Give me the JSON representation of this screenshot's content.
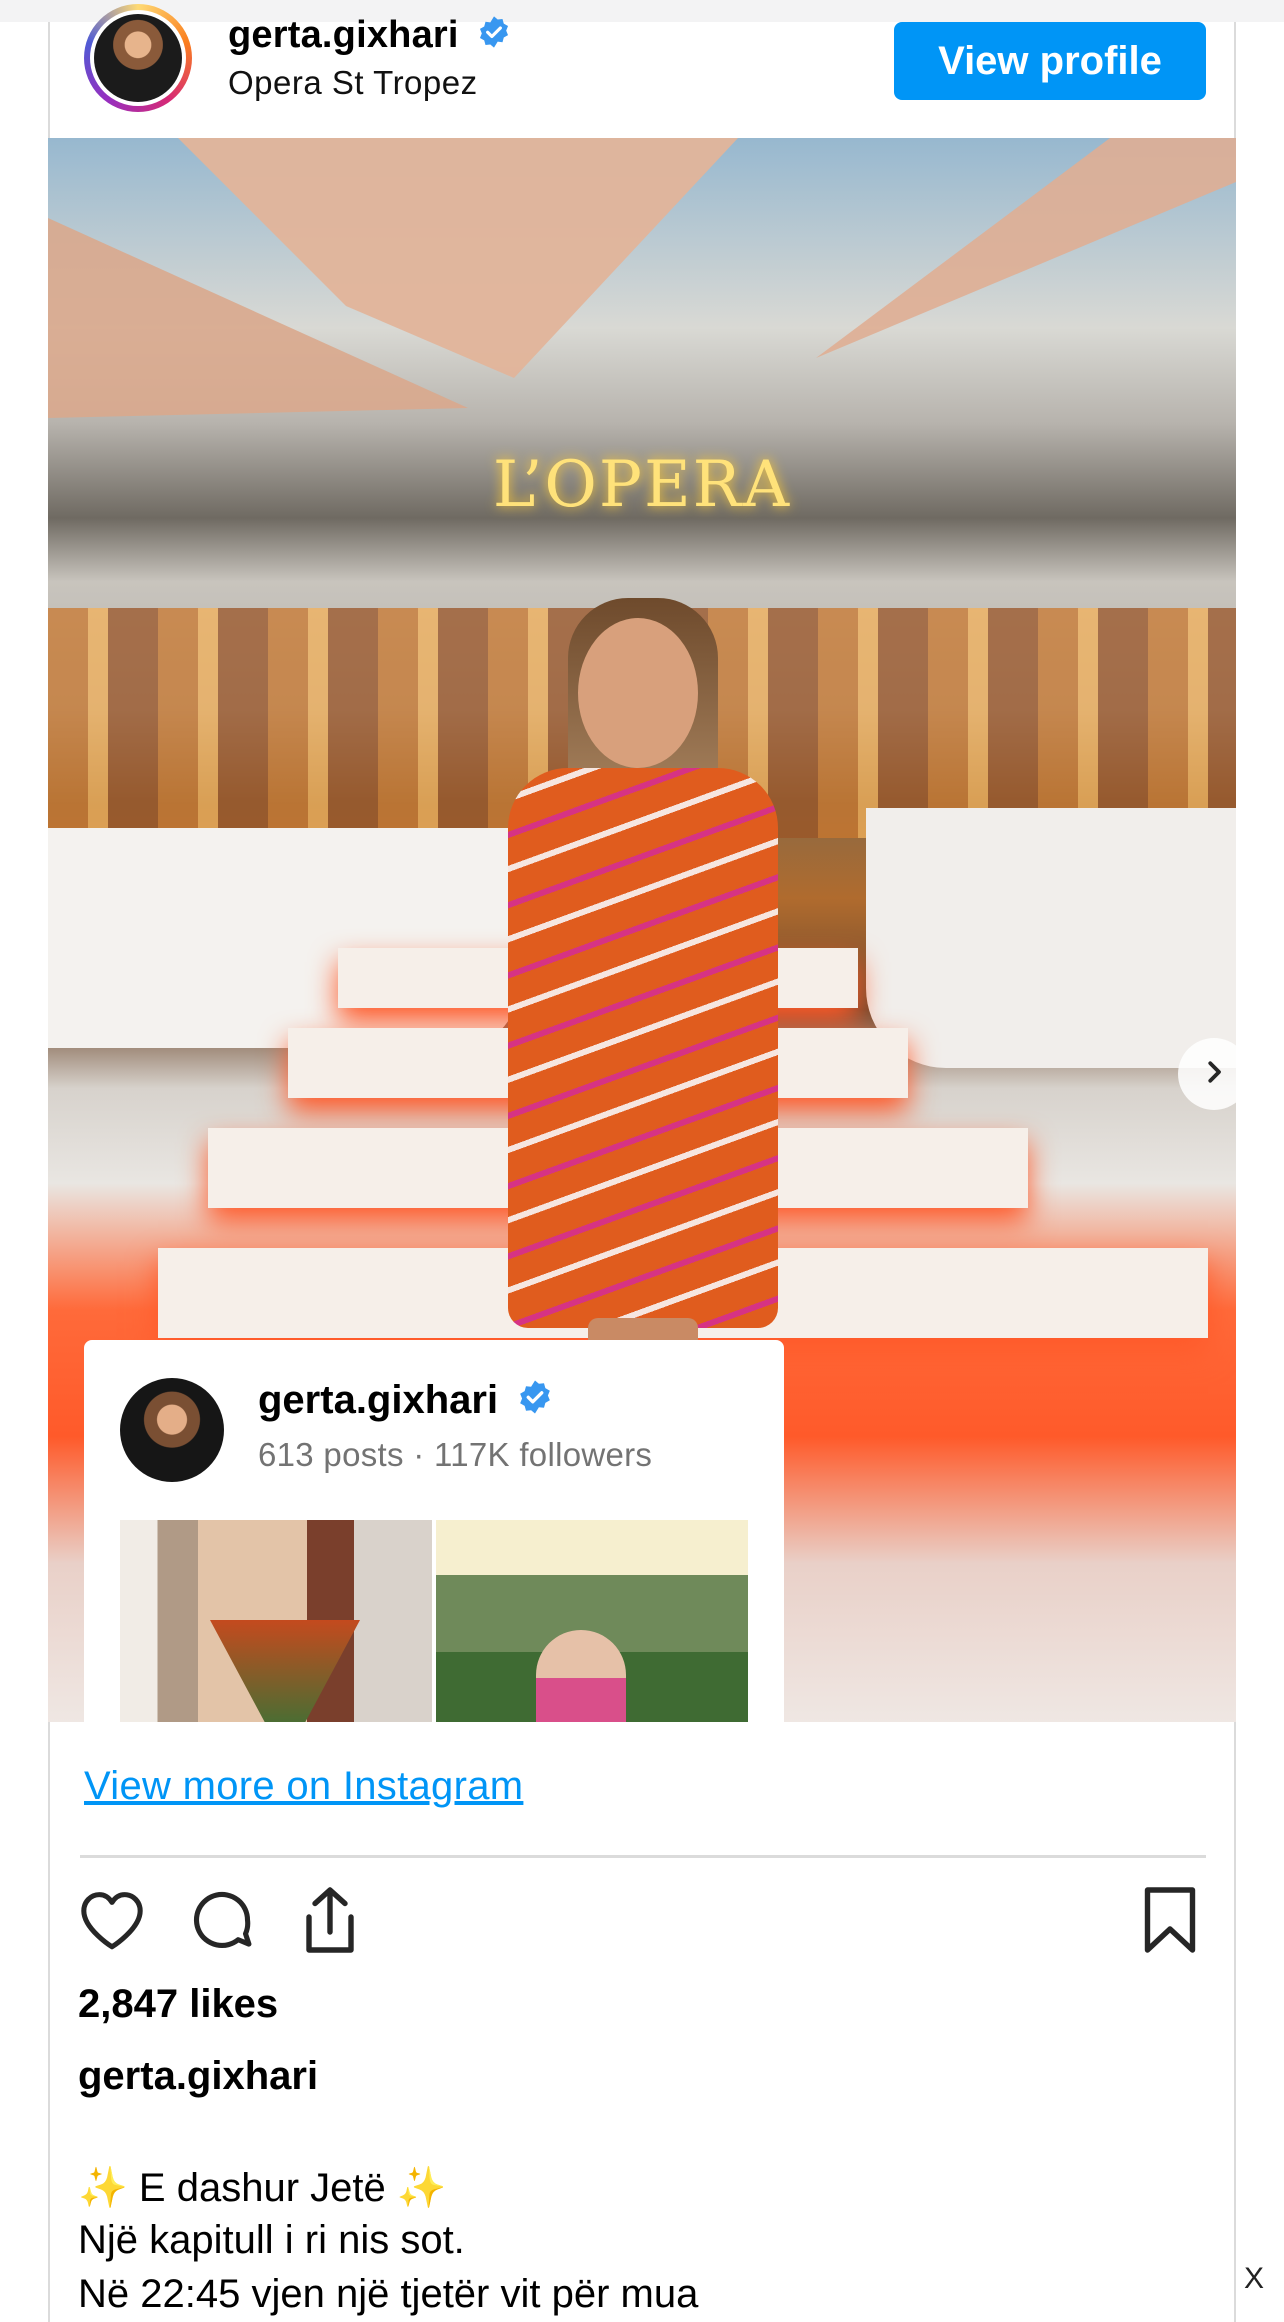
{
  "header": {
    "username": "gerta.gixhari",
    "location": "Opera St Tropez",
    "view_profile_label": "View profile"
  },
  "photo": {
    "sign_text": "L’OPERA"
  },
  "overlay": {
    "username": "gerta.gixhari",
    "stats": "613 posts · 117K followers"
  },
  "links": {
    "view_more": "View more on Instagram"
  },
  "actions": {
    "like_icon": "heart-icon",
    "comment_icon": "comment-icon",
    "share_icon": "share-icon",
    "save_icon": "bookmark-icon"
  },
  "post": {
    "likes": "2,847 likes",
    "caption_user": "gerta.gixhari",
    "caption_lines": [
      "✨ E dashur Jetë ✨",
      "Një kapitull i ri nis sot.",
      "Në 22:45 vjen një tjetër vit për mua"
    ]
  },
  "ad": {
    "close_label": "X"
  },
  "colors": {
    "accent": "#0095f6",
    "divider": "#dbdbdb",
    "secondary_text": "#737373"
  }
}
